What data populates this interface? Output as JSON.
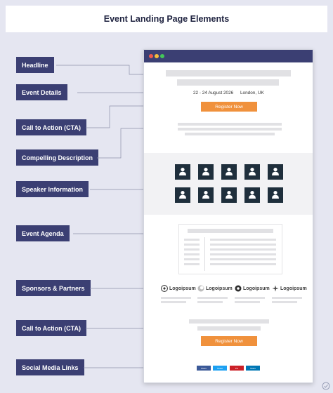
{
  "title": "Event Landing Page Elements",
  "labels": {
    "headline": "Headline",
    "event_details": "Event Details",
    "cta1": "Call to Action (CTA)",
    "description": "Compelling Description",
    "speakers": "Speaker Information",
    "agenda": "Event Agenda",
    "sponsors": "Sponsors & Partners",
    "cta2": "Call to Action (CTA)",
    "social": "Social Media Links"
  },
  "mockup": {
    "event_date": "22 - 24 August 2026",
    "event_location": "London, UK",
    "cta_label": "Register Now",
    "cta2_label": "Register Now",
    "sponsors": [
      "Logoipsum",
      "Logoipsum",
      "Logoipsum",
      "Logoipsum"
    ],
    "social_buttons": [
      "Share",
      "Tweet",
      "Pin",
      "Share"
    ]
  },
  "colors": {
    "label_bg": "#3b3f73",
    "cta": "#f0913c",
    "speaker_tile": "#1f2f3c",
    "social": [
      "#3b5998",
      "#1da1f2",
      "#cb2027",
      "#0077b5"
    ]
  },
  "icons": {
    "speaker": "person-icon",
    "browser_controls": [
      "close-dot-icon",
      "minimize-dot-icon",
      "maximize-dot-icon"
    ]
  }
}
